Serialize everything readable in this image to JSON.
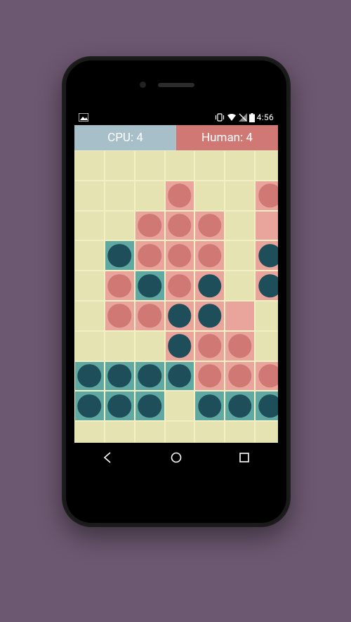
{
  "status_bar": {
    "time": "4:56",
    "icons": [
      "image-icon",
      "vibrate-icon",
      "wifi-icon",
      "signal-icon",
      "battery-icon"
    ]
  },
  "scores": {
    "cpu_label": "CPU: 4",
    "human_label": "Human: 4"
  },
  "palette": {
    "board_bg": "#e6e3b2",
    "grid_line": "#f2efc4",
    "tile_pink": "#e9a59c",
    "tile_teal": "#5fa9a2",
    "disc_pink": "#d07873",
    "disc_teal": "#1e4e5a"
  },
  "board": {
    "cols": 7,
    "rows": 10,
    "tiles": [
      [
        null,
        null,
        null,
        null,
        null,
        null,
        null
      ],
      [
        null,
        null,
        null,
        "pink",
        null,
        null,
        "pink"
      ],
      [
        null,
        null,
        "pink",
        "pink",
        "pink",
        null,
        "pink"
      ],
      [
        null,
        "teal",
        "pink",
        "pink",
        "pink",
        null,
        "pink"
      ],
      [
        null,
        "pink",
        "teal",
        "pink",
        "pink",
        null,
        "pink"
      ],
      [
        null,
        "pink",
        "pink",
        "pink",
        "pink",
        "pink",
        null
      ],
      [
        null,
        null,
        null,
        "pink",
        "pink",
        "pink",
        null
      ],
      [
        "teal",
        "teal",
        "teal",
        "teal",
        "pink",
        "pink",
        "pink"
      ],
      [
        "teal",
        "teal",
        "teal",
        null,
        "teal",
        "teal",
        "teal"
      ],
      [
        null,
        null,
        null,
        null,
        null,
        null,
        null
      ]
    ],
    "discs": [
      [
        null,
        null,
        null,
        null,
        null,
        null,
        null
      ],
      [
        null,
        null,
        null,
        "pink",
        null,
        null,
        "pink"
      ],
      [
        null,
        null,
        "pink",
        "pink",
        "pink",
        null,
        null
      ],
      [
        null,
        "teal",
        "pink",
        "pink",
        "pink",
        null,
        "teal"
      ],
      [
        null,
        "pink",
        "teal",
        "pink",
        "teal",
        null,
        "teal"
      ],
      [
        null,
        "pink",
        "pink",
        "teal",
        "teal",
        null,
        null
      ],
      [
        null,
        null,
        null,
        "teal",
        "pink",
        "pink",
        null
      ],
      [
        "teal",
        "teal",
        "teal",
        "teal",
        "pink",
        "pink",
        "pink"
      ],
      [
        "teal",
        "teal",
        "teal",
        null,
        "teal",
        "teal",
        "teal"
      ],
      [
        null,
        null,
        null,
        null,
        null,
        null,
        null
      ]
    ]
  },
  "nav": {
    "back": "Back",
    "home": "Home",
    "recent": "Recent"
  }
}
